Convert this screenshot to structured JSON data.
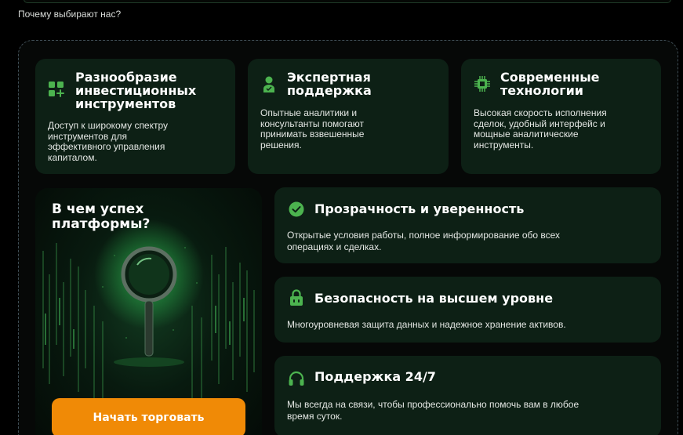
{
  "section_label": "Почему выбирают нас?",
  "top_cards": [
    {
      "title_lines": [
        "Разнообразие",
        "инвестиционных",
        "инструментов"
      ],
      "desc_lines": [
        "Доступ к широкому спектру",
        "инструментов для",
        "эффективного управления",
        "капиталом."
      ],
      "icon": "grid-plus-icon"
    },
    {
      "title_lines": [
        "Экспертная",
        "поддержка"
      ],
      "desc_lines": [
        "Опытные аналитики и",
        "консультанты помогают",
        "принимать взвешенные",
        "решения."
      ],
      "icon": "expert-user-icon"
    },
    {
      "title_lines": [
        "Современные",
        "технологии"
      ],
      "desc_lines": [
        "Высокая скорость исполнения",
        "сделок, удобный интерфейс и",
        "мощные аналитические",
        "инструменты."
      ],
      "icon": "chip-icon"
    }
  ],
  "success": {
    "title_lines": [
      "В чем успех",
      "платформы?"
    ],
    "image": "magnifier-data-illustration"
  },
  "cta_label": "Начать торговать",
  "wide_cards": [
    {
      "title": "Прозрачность и уверенность",
      "desc_lines": [
        "Открытые условия работы, полное информирование обо всех",
        "операциях и сделках."
      ],
      "icon": "check-circle-icon"
    },
    {
      "title": "Безопасность на высшем уровне",
      "desc_lines": [
        "Многоуровневая защита данных и надежное хранение активов."
      ],
      "icon": "lock-icon"
    },
    {
      "title": "Поддержка 24/7",
      "desc_lines": [
        "Мы всегда на связи, чтобы профессионально помочь вам в любое",
        "время суток."
      ],
      "icon": "headphones-icon"
    }
  ],
  "colors": {
    "accent_green": "#4cb34f",
    "card_bg": "#0d2015",
    "cta_orange": "#f08a06",
    "page_bg": "#000000"
  }
}
